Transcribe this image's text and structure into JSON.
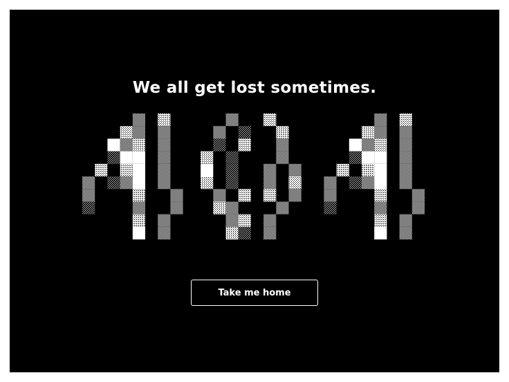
{
  "headline": "We all get lost sometimes.",
  "art": {
    "digits": "404",
    "colors": {
      "background": "#000000",
      "solid": "#ffffff",
      "light_dither": "#e0e0e0",
      "dark_dither": "#6a6a6a"
    }
  },
  "button": {
    "label": "Take me home",
    "border_color": "#ffffff",
    "text_color": "#ffffff"
  }
}
